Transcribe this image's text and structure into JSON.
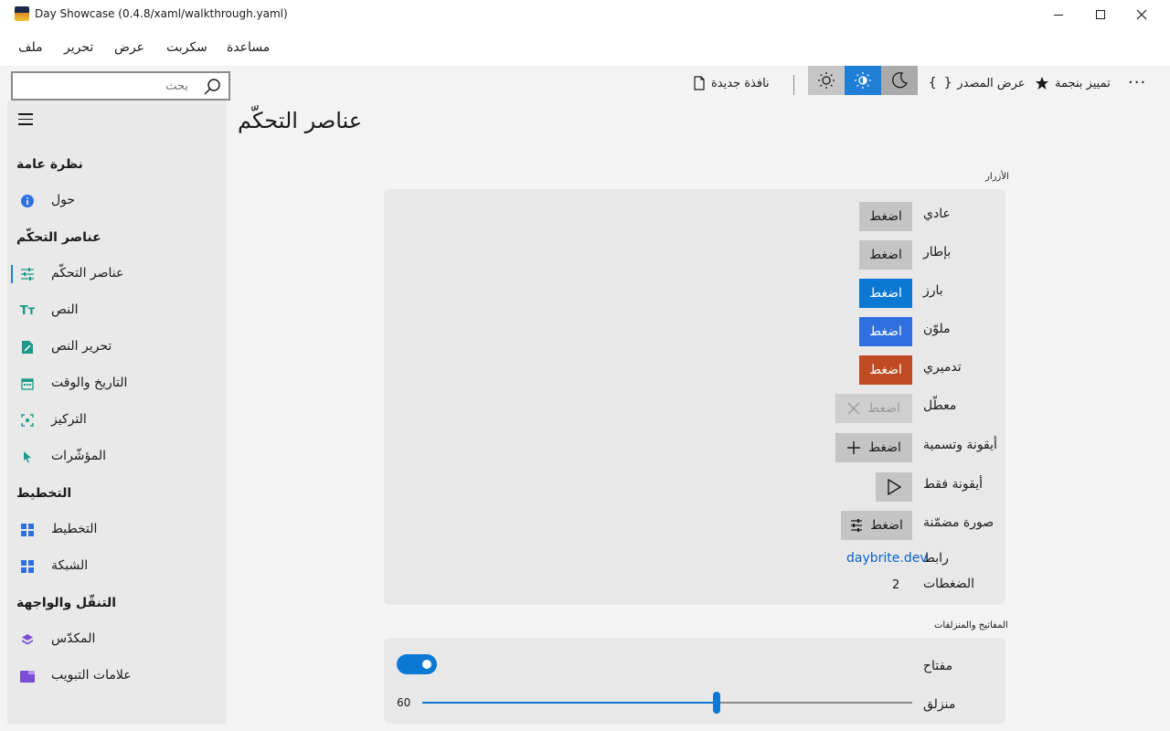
{
  "window": {
    "title": "Day Showcase (0.4.8/xaml/walkthrough.yaml)"
  },
  "menu": {
    "items": [
      "ملف",
      "تحرير",
      "عرض",
      "سكربت",
      "مساعدة"
    ]
  },
  "toolbar": {
    "search_placeholder": "بحث",
    "new_window": "نافذة جديدة",
    "view_source": "عرض المصدر",
    "star_label": "تمييز بنجمة",
    "theme_active": "auto"
  },
  "sidebar": {
    "sections": [
      {
        "title": "نظرة عامة",
        "items": [
          {
            "label": "حول",
            "icon": "info-icon"
          }
        ]
      },
      {
        "title": "عناصر التحكّم",
        "items": [
          {
            "label": "عناصر التحكّم",
            "icon": "sliders-icon",
            "selected": true
          },
          {
            "label": "النص",
            "icon": "text-icon"
          },
          {
            "label": "تحرير النص",
            "icon": "edit-text-icon"
          },
          {
            "label": "التاريخ والوقت",
            "icon": "calendar-icon"
          },
          {
            "label": "التركيز",
            "icon": "focus-icon"
          },
          {
            "label": "المؤشّرات",
            "icon": "pointer-icon"
          }
        ]
      },
      {
        "title": "التخطيط",
        "items": [
          {
            "label": "التخطيط",
            "icon": "layout-icon"
          },
          {
            "label": "الشبكة",
            "icon": "grid-icon"
          }
        ]
      },
      {
        "title": "التنقّل والواجهة",
        "items": [
          {
            "label": "المكدّس",
            "icon": "stack-icon"
          },
          {
            "label": "علامات التبويب",
            "icon": "tabs-icon"
          }
        ]
      }
    ]
  },
  "main": {
    "title": "عناصر التحكّم",
    "buttons_section": {
      "heading": "الأزرار",
      "rows": [
        {
          "label": "عادي",
          "button": "اضغط"
        },
        {
          "label": "بإطار",
          "button": "اضغط"
        },
        {
          "label": "بارز",
          "button": "اضغط"
        },
        {
          "label": "ملوّن",
          "button": "اضغط"
        },
        {
          "label": "تدميري",
          "button": "اضغط"
        },
        {
          "label": "معطّل",
          "button": "اضغط"
        },
        {
          "label": "أيقونة وتسمية",
          "button": "اضغط"
        },
        {
          "label": "أيقونة فقط",
          "button": ""
        },
        {
          "label": "صورة مضمّنة",
          "button": "اضغط"
        }
      ],
      "link_label": "رابط",
      "link_text": "daybrite.dev",
      "clicks_label": "الضغطات",
      "clicks_value": "2"
    },
    "switches_section": {
      "heading": "المفاتيح والمنزلقات",
      "switch_label": "مفتاح",
      "switch_on": true,
      "slider_label": "منزلق",
      "slider_value": "60",
      "slider_min": 0,
      "slider_max": 100
    }
  },
  "colors": {
    "accent": "#0b78d4",
    "colored": "#2f6fe0",
    "danger": "#c04a21"
  }
}
